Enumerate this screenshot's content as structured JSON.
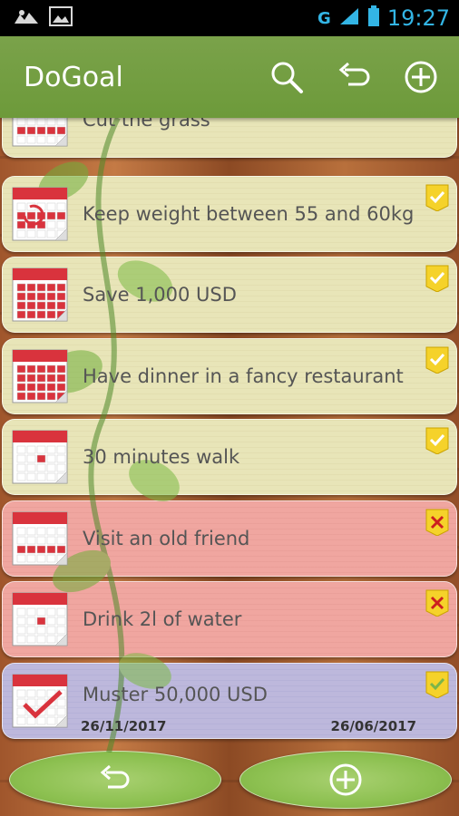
{
  "status_bar": {
    "network": "G",
    "time": "19:27",
    "icons": [
      "cloud-icon",
      "image-icon",
      "signal-icon",
      "battery-icon"
    ]
  },
  "app": {
    "title": "DoGoal",
    "actions": [
      "search-icon",
      "undo-icon",
      "add-icon"
    ]
  },
  "goals": [
    {
      "label": "Cut the grass",
      "state": "pending",
      "calendar": "row"
    },
    {
      "label": "Keep weight between 55 and 60kg",
      "state": "pending",
      "calendar": "repeat"
    },
    {
      "label": "Save 1,000 USD",
      "state": "pending",
      "calendar": "stack"
    },
    {
      "label": "Have dinner in a fancy restaurant",
      "state": "pending",
      "calendar": "stack"
    },
    {
      "label": "30 minutes walk",
      "state": "pending",
      "calendar": "dot"
    },
    {
      "label": "Visit an old friend",
      "state": "failed",
      "calendar": "row"
    },
    {
      "label": "Drink 2l of water",
      "state": "failed",
      "calendar": "dot"
    },
    {
      "label": "Muster 50,000 USD",
      "state": "done",
      "calendar": "check",
      "start_date": "26/11/2017",
      "end_date": "26/06/2017"
    }
  ],
  "bottom_bar": {
    "buttons": [
      "undo-icon",
      "add-icon"
    ]
  },
  "colors": {
    "action_bar": "#6d9a3a",
    "pending": "#e8e5b8",
    "failed": "#f0a6a0",
    "done": "#bdb8dc",
    "calendar_red": "#d9333d",
    "flag_yellow": "#f5d22a",
    "status_blue": "#33b5e5"
  }
}
